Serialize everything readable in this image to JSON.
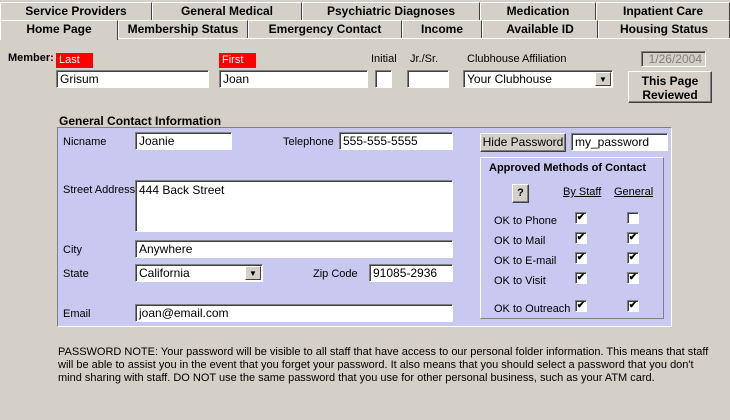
{
  "tabs_row1": [
    "Service Providers",
    "General Medical",
    "Psychiatric Diagnoses",
    "Medication",
    "Inpatient Care"
  ],
  "tabs_row2": [
    "Home Page",
    "Membership Status",
    "Emergency Contact",
    "Income",
    "Available ID",
    "Housing Status"
  ],
  "member": {
    "label": "Member:",
    "last_label": "Last",
    "first_label": "First",
    "initial_label": "Initial",
    "suffix_label": "Jr./Sr.",
    "last_value": "Grisum",
    "first_value": "Joan",
    "initial_value": "",
    "suffix_value": ""
  },
  "clubhouse": {
    "label": "Clubhouse Affiliation",
    "value": "Your Clubhouse"
  },
  "date": "1/26/2004",
  "reviewed_button": "This Page Reviewed",
  "contact": {
    "section_title": "General Contact Information",
    "nickname_label": "Nicname",
    "nickname_value": "Joanie",
    "telephone_label": "Telephone",
    "telephone_value": "555-555-5555",
    "street_label": "Street Address",
    "street_value": "444 Back Street",
    "city_label": "City",
    "city_value": "Anywhere",
    "state_label": "State",
    "state_value": "California",
    "zip_label": "Zip Code",
    "zip_value": "91085-2936",
    "email_label": "Email",
    "email_value": "joan@email.com"
  },
  "password": {
    "button": "Hide Password",
    "value": "my_password"
  },
  "methods": {
    "title": "Approved Methods of Contact",
    "help_button": "?",
    "by_staff": "By Staff",
    "general": "General",
    "rows": [
      {
        "label": "OK to Phone",
        "staff": true,
        "general": false
      },
      {
        "label": "OK to Mail",
        "staff": true,
        "general": true
      },
      {
        "label": "OK to E-mail",
        "staff": true,
        "general": true
      },
      {
        "label": "OK to Visit",
        "staff": true,
        "general": true
      },
      {
        "label": "OK to Outreach",
        "staff": true,
        "general": true
      }
    ]
  },
  "password_note": "PASSWORD NOTE:  Your password will be visible to all staff that have access to our personal folder information.  This means that staff will be able to assist you in the event that you forget your password.  It also means that you should select a password that you don't mind sharing with staff.  DO NOT use the same password that you use for other personal business, such as your ATM card."
}
